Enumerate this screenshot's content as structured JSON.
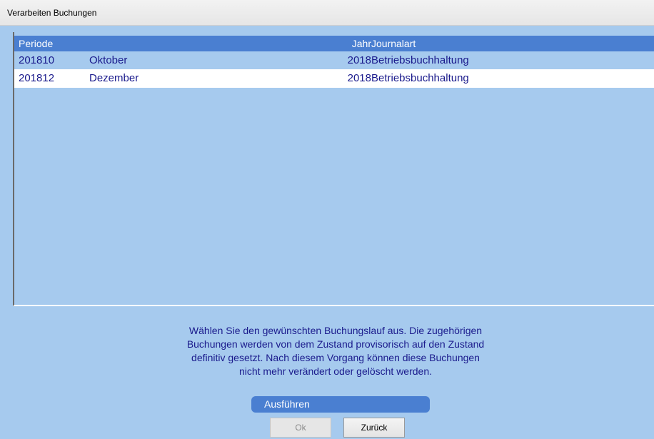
{
  "window": {
    "title": "Verarbeiten Buchungen"
  },
  "table": {
    "headers": {
      "periode": "Periode",
      "jahr": "Jahr",
      "journalart": "Journalart"
    },
    "rows": [
      {
        "periode": "201810",
        "month": "Oktober",
        "jahr": "2018",
        "journalart": "Betriebsbuchhaltung"
      },
      {
        "periode": "201812",
        "month": "Dezember",
        "jahr": "2018",
        "journalart": "Betriebsbuchhaltung"
      }
    ]
  },
  "info": {
    "lines": [
      "Wählen Sie den gewünschten Buchungslauf aus. Die zugehörigen",
      "Buchungen werden von dem Zustand provisorisch auf den Zustand",
      "definitiv gesetzt. Nach diesem Vorgang können diese Buchungen",
      "nicht mehr verändert oder gelöscht werden."
    ]
  },
  "actions": {
    "run_label": "Ausführen",
    "ok_label": "Ok",
    "back_label": "Zurück"
  },
  "colors": {
    "background": "#a6caee",
    "header": "#4a7fd1",
    "text": "#1a1a8c",
    "selected_row": "#ffffff"
  }
}
